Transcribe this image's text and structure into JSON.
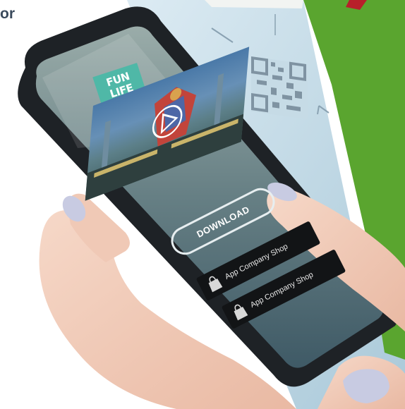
{
  "corner_text": "or",
  "app_logo": {
    "line1": "FUN",
    "line2": "LIFE"
  },
  "video": {
    "play_icon": "play-icon"
  },
  "download_label": "DOWNLOAD",
  "store_buttons": [
    {
      "label": "App Company Shop",
      "icon": "shopping-bag-icon"
    },
    {
      "label": "App Company Shop",
      "icon": "shopping-bag-icon"
    }
  ],
  "colors": {
    "poster_green": "#5aa52f",
    "poster_blue": "#c9dfe9",
    "logo_teal": "#4fb8a7",
    "phone_body": "#1e2226",
    "screen_tint": "#5f7f86",
    "store_button_bg": "#121416"
  }
}
